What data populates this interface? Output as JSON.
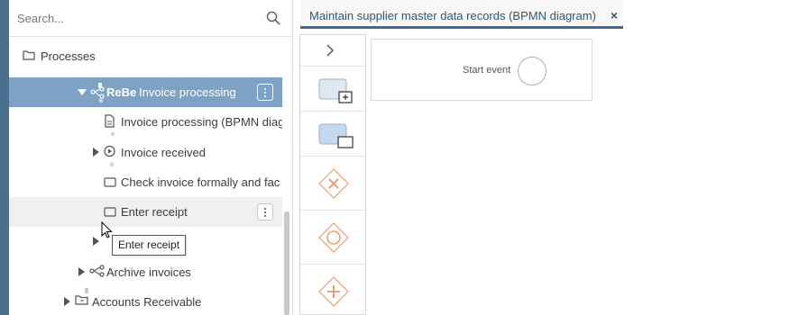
{
  "search": {
    "placeholder": "Search..."
  },
  "tree": {
    "processes_label": "Processes",
    "selected_item": {
      "prefix": "ReBe",
      "label": "Invoice processing"
    },
    "items": [
      {
        "label": "Invoice processing (BPMN diag"
      },
      {
        "label": "Invoice received"
      },
      {
        "label": "Check invoice formally and fac"
      },
      {
        "label": "Enter receipt"
      },
      {
        "label": "Archive invoices"
      },
      {
        "label": "Accounts Receivable"
      }
    ]
  },
  "tooltip": {
    "text": "Enter receipt"
  },
  "tabs": [
    {
      "label": "Maintain supplier master data records (BPMN diagram)",
      "close": "×"
    }
  ],
  "canvas": {
    "start_event_label": "Start event"
  },
  "palette": {
    "items": [
      "expand-chevron-icon",
      "subprocess-icon",
      "task-icon",
      "exclusive-gateway-icon",
      "event-gateway-icon",
      "parallel-gateway-icon"
    ]
  },
  "colors": {
    "accent": "#3d6a90",
    "selected_row": "#7ea2c5",
    "gateway_orange": "#f0a070"
  }
}
